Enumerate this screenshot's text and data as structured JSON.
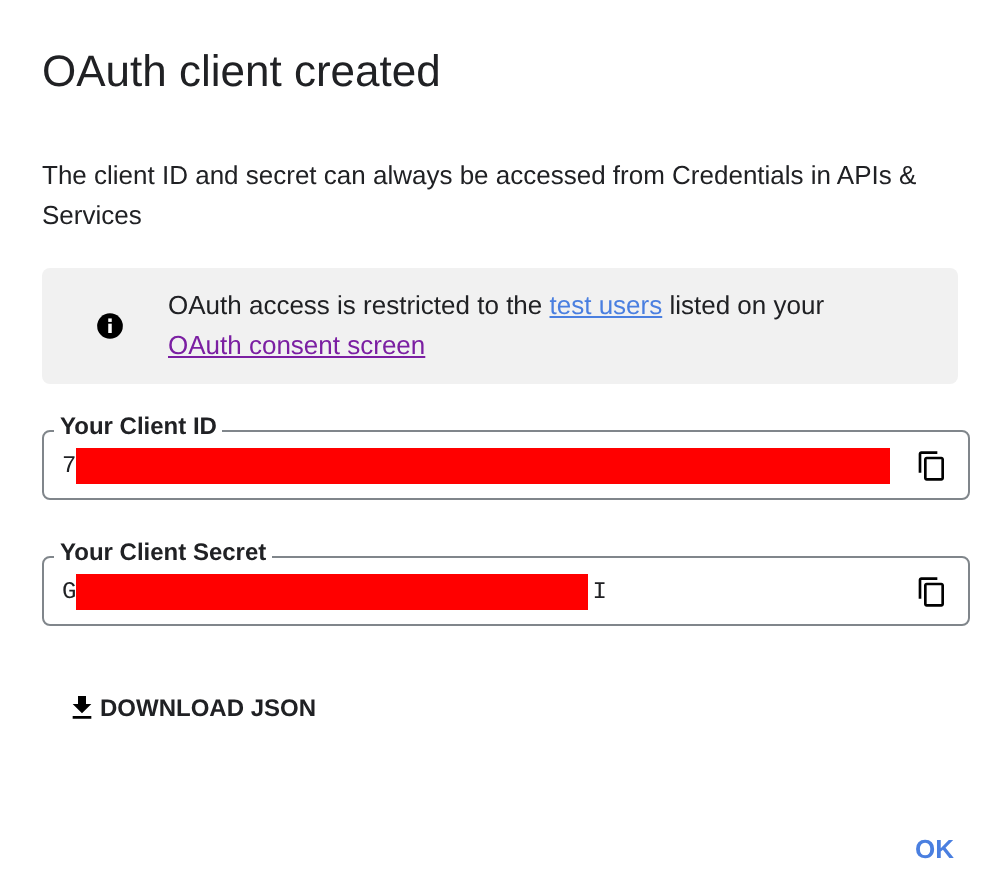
{
  "dialog": {
    "title": "OAuth client created",
    "description": "The client ID and secret can always be accessed from Credentials in APIs & Services",
    "notice": {
      "parts": [
        {
          "kind": "text",
          "text": "OAuth access is restricted to the "
        },
        {
          "kind": "link",
          "text": "test users",
          "visited": false
        },
        {
          "kind": "text",
          "text": " listed on your "
        },
        {
          "kind": "link",
          "text": "OAuth consent screen",
          "visited": true
        }
      ]
    },
    "fields": [
      {
        "label": "Your Client ID",
        "value_start": "7",
        "redacted": true
      },
      {
        "label": "Your Client Secret",
        "value_start": "G",
        "value_end": "I",
        "redacted": true
      }
    ],
    "download_button": "DOWNLOAD JSON",
    "ok_button": "OK"
  }
}
